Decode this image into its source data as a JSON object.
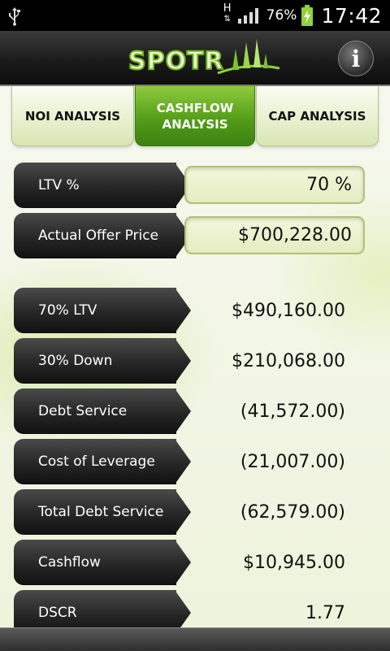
{
  "status": {
    "network_letter": "H",
    "battery_text": "76%",
    "time": "17:42"
  },
  "app": {
    "logo_text": "SPOTR",
    "info_label": "i"
  },
  "tabs": [
    {
      "label": "NOI ANALYSIS",
      "active": false
    },
    {
      "label": "CASHFLOW ANALYSIS",
      "active": true
    },
    {
      "label": "CAP ANALYSIS",
      "active": false
    }
  ],
  "inputs": [
    {
      "label": "LTV %",
      "value": "70 %"
    },
    {
      "label": "Actual Offer Price",
      "value": "$700,228.00"
    }
  ],
  "results": [
    {
      "label": "70% LTV",
      "value": "$490,160.00"
    },
    {
      "label": "30% Down",
      "value": "$210,068.00"
    },
    {
      "label": "Debt Service",
      "value": "(41,572.00)"
    },
    {
      "label": "Cost of Leverage",
      "value": "(21,007.00)"
    },
    {
      "label": "Total Debt Service",
      "value": "(62,579.00)"
    },
    {
      "label": "Cashflow",
      "value": "$10,945.00"
    },
    {
      "label": "DSCR",
      "value": "1.77"
    }
  ],
  "colors": {
    "accent_green": "#5aa91e",
    "label_dark": "#262626",
    "value_bg": "#e6efc6"
  }
}
